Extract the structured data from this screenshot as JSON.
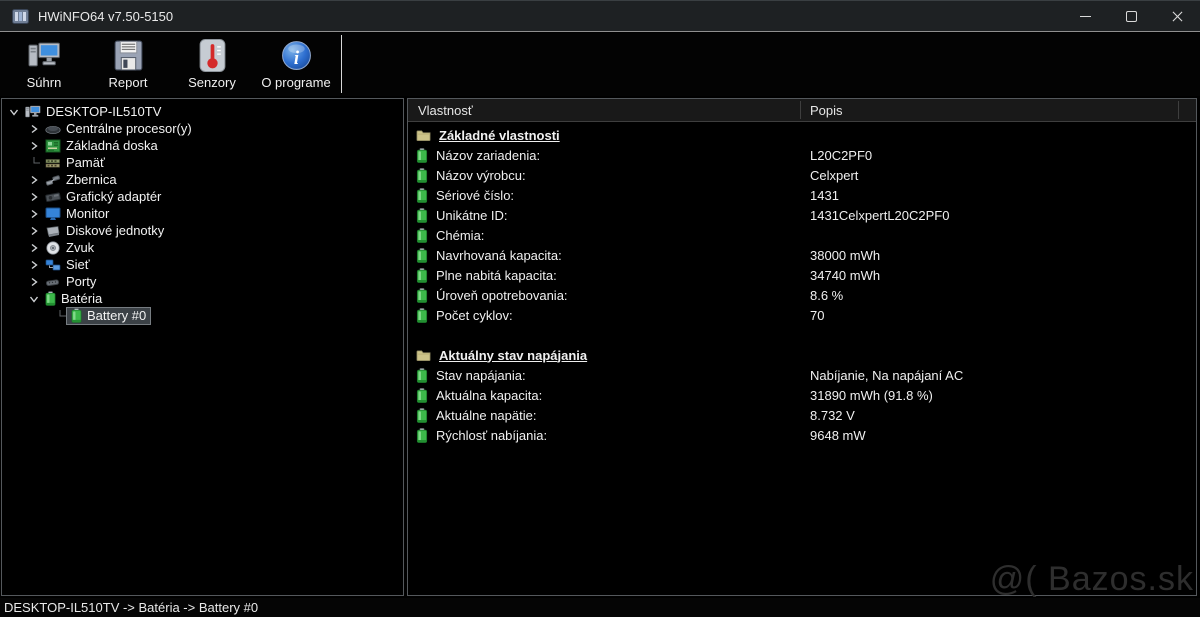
{
  "window": {
    "title": "HWiNFO64 v7.50-5150"
  },
  "toolbar": {
    "buttons": [
      {
        "name": "summary",
        "label": "Súhrn",
        "icon": "computer-icon"
      },
      {
        "name": "report",
        "label": "Report",
        "icon": "floppy-icon"
      },
      {
        "name": "sensors",
        "label": "Senzory",
        "icon": "thermometer-icon"
      },
      {
        "name": "about",
        "label": "O programe",
        "icon": "info-icon"
      }
    ]
  },
  "tree": {
    "root": {
      "name": "computer",
      "label": "DESKTOP-IL510TV",
      "icon": "computer-icon",
      "state": "expanded"
    },
    "items": [
      {
        "name": "cpu",
        "label": "Centrálne procesor(y)",
        "icon": "cpu-icon",
        "state": "collapsed"
      },
      {
        "name": "motherboard",
        "label": "Základná doska",
        "icon": "motherboard-icon",
        "state": "collapsed"
      },
      {
        "name": "memory",
        "label": "Pamäť",
        "icon": "memory-icon",
        "state": "leaf"
      },
      {
        "name": "bus",
        "label": "Zbernica",
        "icon": "bus-icon",
        "state": "collapsed"
      },
      {
        "name": "gpu",
        "label": "Grafický adaptér",
        "icon": "gpu-icon",
        "state": "collapsed"
      },
      {
        "name": "monitor",
        "label": "Monitor",
        "icon": "monitor-icon",
        "state": "collapsed"
      },
      {
        "name": "disks",
        "label": "Diskové jednotky",
        "icon": "disk-icon",
        "state": "collapsed"
      },
      {
        "name": "sound",
        "label": "Zvuk",
        "icon": "sound-icon",
        "state": "collapsed"
      },
      {
        "name": "network",
        "label": "Sieť",
        "icon": "network-icon",
        "state": "collapsed"
      },
      {
        "name": "ports",
        "label": "Porty",
        "icon": "ports-icon",
        "state": "collapsed"
      },
      {
        "name": "battery",
        "label": "Batéria",
        "icon": "battery-icon",
        "state": "expanded"
      },
      {
        "name": "battery-0",
        "label": "Battery #0",
        "icon": "battery-icon",
        "state": "child",
        "selected": true
      }
    ]
  },
  "table": {
    "headers": {
      "property": "Vlastnosť",
      "description": "Popis"
    },
    "sections": [
      {
        "title": "Základné vlastnosti",
        "rows": [
          {
            "label": "Názov zariadenia:",
            "value": "L20C2PF0"
          },
          {
            "label": "Názov výrobcu:",
            "value": "Celxpert"
          },
          {
            "label": "Sériové číslo:",
            "value": "1431"
          },
          {
            "label": "Unikátne ID:",
            "value": "1431CelxpertL20C2PF0"
          },
          {
            "label": "Chémia:",
            "value": ""
          },
          {
            "label": "Navrhovaná kapacita:",
            "value": "38000 mWh"
          },
          {
            "label": "Plne nabitá kapacita:",
            "value": "34740 mWh"
          },
          {
            "label": "Úroveň opotrebovania:",
            "value": "8.6 %"
          },
          {
            "label": "Počet cyklov:",
            "value": "70"
          }
        ]
      },
      {
        "title": "Aktuálny stav napájania",
        "rows": [
          {
            "label": "Stav napájania:",
            "value": "Nabíjanie, Na napájaní AC"
          },
          {
            "label": "Aktuálna kapacita:",
            "value": "31890 mWh (91.8 %)"
          },
          {
            "label": "Aktuálne napätie:",
            "value": "8.732 V"
          },
          {
            "label": "Rýchlosť nabíjania:",
            "value": "9648 mW"
          }
        ]
      }
    ]
  },
  "statusbar": {
    "text": "DESKTOP-IL510TV -> Batéria -> Battery #0"
  },
  "watermark": {
    "text": "@( Bazos.sk"
  },
  "colors": {
    "battery_green": "#3cb84a",
    "folder_tan": "#cdc489",
    "selection_bg": "#3b4146",
    "screen_blue": "#3583d8",
    "sensor_red": "#d42a2a"
  }
}
